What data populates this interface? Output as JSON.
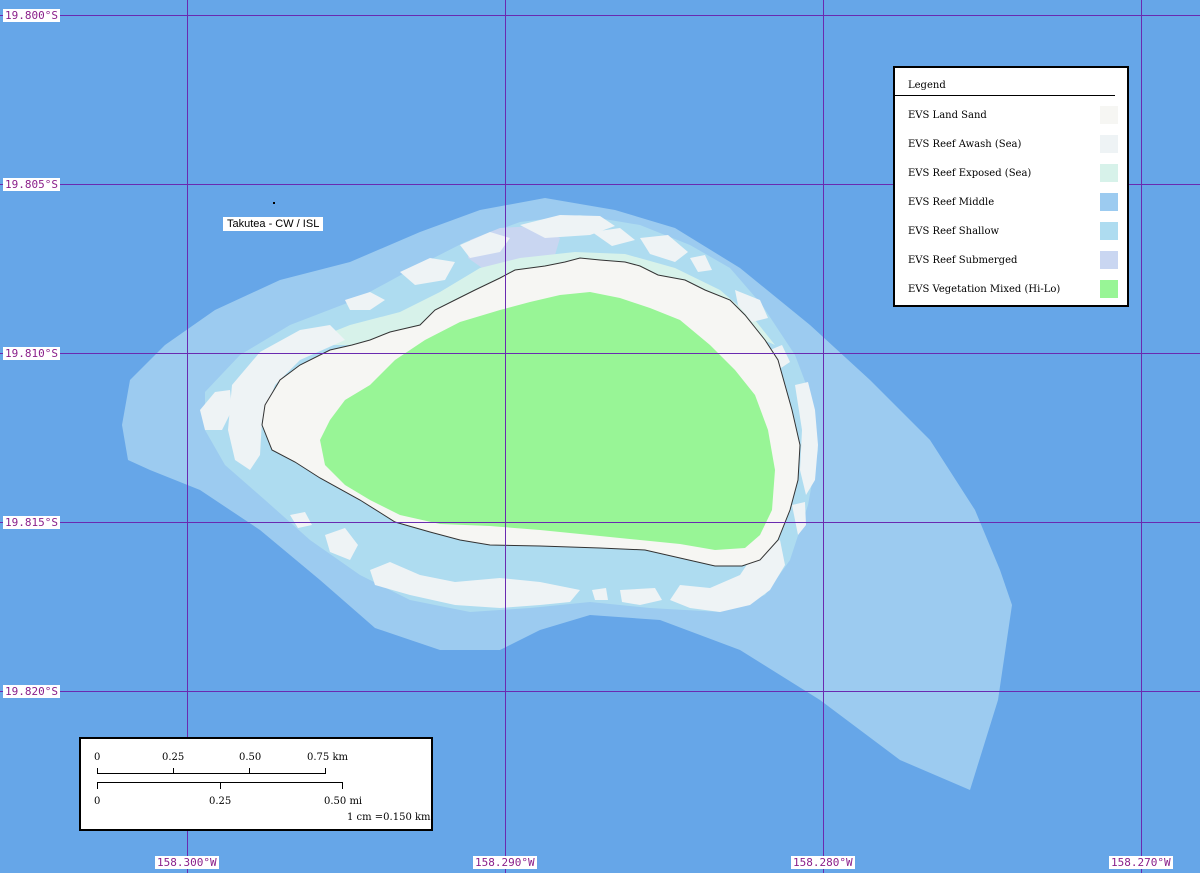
{
  "map": {
    "grid": {
      "lat_labels": [
        "19.800°S",
        "19.805°S",
        "19.810°S",
        "19.815°S",
        "19.820°S"
      ],
      "lon_labels": [
        "158.300°W",
        "158.290°W",
        "158.280°W",
        "158.270°W"
      ]
    },
    "place": {
      "name": "Takutea - CW / ISL"
    },
    "colors": {
      "ocean": "#66a6e8",
      "reef_submerged": "#9ccbf0",
      "reef_shallow": "#aedcf0",
      "reef_awash": "#eef3f5",
      "reef_exposed": "#d7f2ea",
      "reef_middle": "#c9d6f1",
      "land_sand": "#f6f6f3",
      "vegetation": "#98f596",
      "grid_line": "#6a2ab0"
    },
    "legend": {
      "title": "Legend",
      "items": [
        {
          "label": "EVS Land Sand",
          "color": "#f6f6f3"
        },
        {
          "label": "EVS Reef Awash (Sea)",
          "color": "#eef3f5"
        },
        {
          "label": "EVS Reef Exposed (Sea)",
          "color": "#d7f2ea"
        },
        {
          "label": "EVS Reef Middle",
          "color": "#9ccbf0"
        },
        {
          "label": "EVS Reef Shallow",
          "color": "#aedcf0"
        },
        {
          "label": "EVS Reef Submerged",
          "color": "#c9d6f1"
        },
        {
          "label": "EVS Vegetation Mixed (Hi-Lo)",
          "color": "#98f596"
        }
      ]
    },
    "scale": {
      "km_ticks": [
        "0",
        "0.25",
        "0.50",
        "0.75 km"
      ],
      "mi_ticks": [
        "0",
        "0.25",
        "0.50 mi"
      ],
      "ratio": "1 cm =0.150 km"
    }
  }
}
